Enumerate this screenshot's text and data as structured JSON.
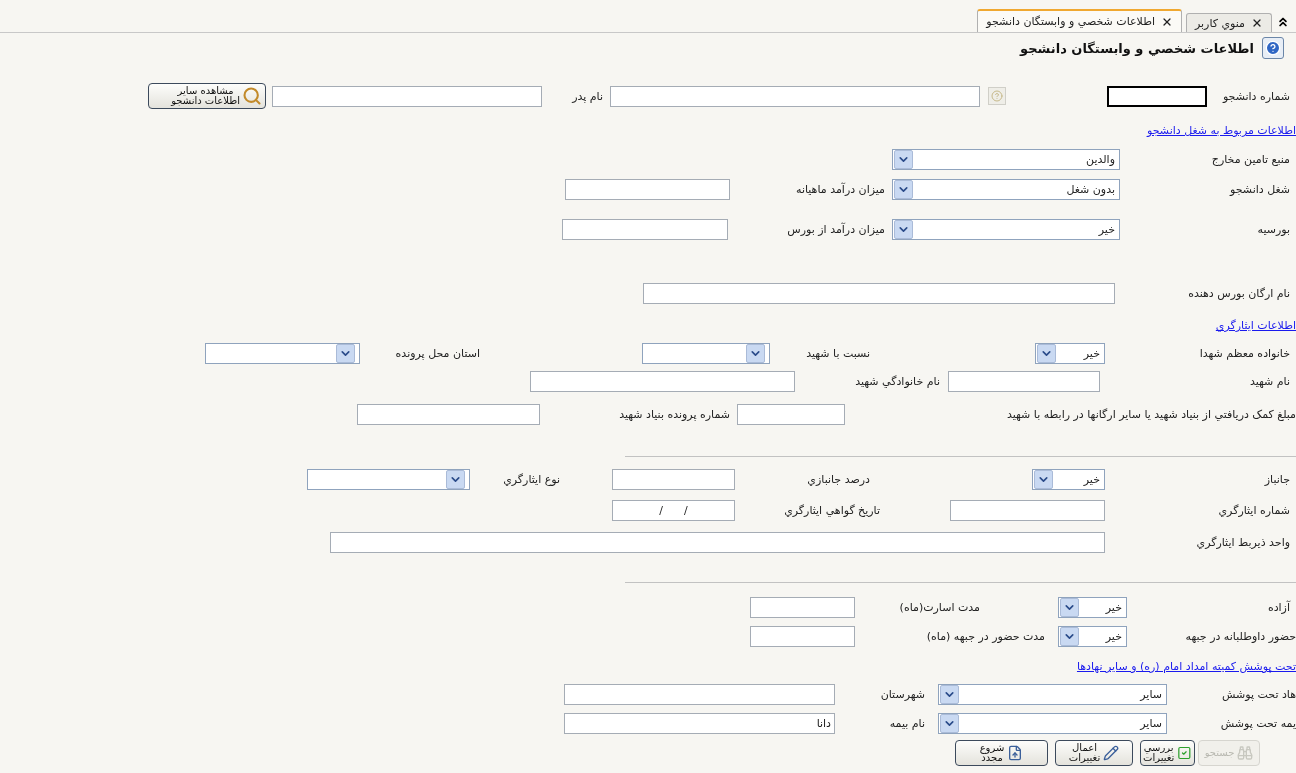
{
  "tabs": [
    {
      "label": "منوي كاربر",
      "selected": false
    },
    {
      "label": "اطلاعات شخصي و وابستگان دانشجو",
      "selected": true
    }
  ],
  "title": "اطلاعات شخصي و وابستگان دانشجو",
  "rows": [
    {
      "kind": "fields",
      "items": [
        {
          "kind": "label",
          "text": "شماره دانشجو"
        },
        {
          "kind": "input",
          "focused": true
        },
        {
          "kind": "help"
        },
        {
          "kind": "input",
          "focused": false
        },
        {
          "kind": "label",
          "text": "نام پدر"
        },
        {
          "kind": "input",
          "focused": false
        },
        {
          "kind": "button",
          "lines": [
            "مشاهده ساير",
            "اطلاعات دانشجو"
          ]
        }
      ]
    },
    {
      "kind": "link",
      "text": "اطلاعات مربوط به شغل دانشجو"
    },
    {
      "kind": "fields",
      "items": [
        {
          "kind": "label",
          "text": "منبع تامين مخارج"
        },
        {
          "kind": "select",
          "value": "والدين"
        }
      ]
    },
    {
      "kind": "fields",
      "items": [
        {
          "kind": "label",
          "text": "شغل دانشجو"
        },
        {
          "kind": "select",
          "value": "بدون شغل"
        },
        {
          "kind": "label",
          "text": "ميزان درآمد ماهيانه"
        },
        {
          "kind": "input",
          "focused": false
        }
      ]
    },
    {
      "kind": "fields",
      "items": [
        {
          "kind": "label",
          "text": "بورسيه"
        },
        {
          "kind": "select",
          "value": "خير"
        },
        {
          "kind": "label",
          "text": "ميزان درآمد از بورس"
        },
        {
          "kind": "input",
          "focused": false
        }
      ]
    },
    {
      "kind": "fields",
      "items": [
        {
          "kind": "label",
          "text": "نام ارگان بورس دهنده"
        },
        {
          "kind": "input",
          "focused": false
        }
      ]
    },
    {
      "kind": "link",
      "text": "اطلاعات ايثارگري"
    },
    {
      "kind": "fields",
      "items": [
        {
          "kind": "label",
          "text": "خانواده معظم شهدا"
        },
        {
          "kind": "select",
          "value": "خير"
        },
        {
          "kind": "label",
          "text": "نسبت با شهيد"
        },
        {
          "kind": "select"
        },
        {
          "kind": "label",
          "text": "استان محل پرونده"
        },
        {
          "kind": "select"
        }
      ]
    },
    {
      "kind": "fields",
      "items": [
        {
          "kind": "label",
          "text": "نام شهيد"
        },
        {
          "kind": "input",
          "focused": false
        },
        {
          "kind": "label",
          "text": "نام خانوادگي شهيد"
        },
        {
          "kind": "input",
          "focused": false
        }
      ]
    },
    {
      "kind": "fields",
      "items": [
        {
          "kind": "label",
          "text": "مبلغ کمک دريافتي از بنياد شهيد يا ساير ارگانها در رابطه با شهيد"
        },
        {
          "kind": "input",
          "focused": false
        },
        {
          "kind": "label",
          "text": "شماره پرونده بنياد شهيد"
        },
        {
          "kind": "input",
          "focused": false
        }
      ]
    },
    {
      "kind": "divider"
    },
    {
      "kind": "fields",
      "items": [
        {
          "kind": "label",
          "text": "جانباز"
        },
        {
          "kind": "select",
          "value": "خير"
        },
        {
          "kind": "label",
          "text": "درصد جانبازي"
        },
        {
          "kind": "input",
          "focused": false
        },
        {
          "kind": "label",
          "text": "نوع ايثارگري"
        },
        {
          "kind": "select"
        }
      ]
    },
    {
      "kind": "fields",
      "items": [
        {
          "kind": "label",
          "text": "شماره ايثارگري"
        },
        {
          "kind": "input",
          "focused": false
        },
        {
          "kind": "label",
          "text": "تاريخ گواهي ايثارگري"
        },
        {
          "kind": "date",
          "value": "/      /"
        }
      ]
    },
    {
      "kind": "fields",
      "items": [
        {
          "kind": "label",
          "text": "واحد ذيربط ايثارگري"
        },
        {
          "kind": "input",
          "focused": false
        }
      ]
    },
    {
      "kind": "divider"
    },
    {
      "kind": "fields",
      "items": [
        {
          "kind": "label",
          "text": "آزاده"
        },
        {
          "kind": "select",
          "value": "خير"
        },
        {
          "kind": "label",
          "text": "مدت اسارت(ماه)"
        },
        {
          "kind": "input",
          "focused": false
        }
      ]
    },
    {
      "kind": "fields",
      "items": [
        {
          "kind": "label",
          "text": "حضور داوطلبانه در جبهه"
        },
        {
          "kind": "select",
          "value": "خير"
        },
        {
          "kind": "label",
          "text": "مدت حضور در جبهه (ماه)"
        },
        {
          "kind": "input",
          "focused": false
        }
      ]
    },
    {
      "kind": "link",
      "text": "تحت پوشش كميته امداد امام (ره) و ساير نهادها"
    },
    {
      "kind": "fields",
      "items": [
        {
          "kind": "label",
          "text": "هاد تحت پوشش"
        },
        {
          "kind": "select",
          "value": "ساير"
        },
        {
          "kind": "label",
          "text": "شهرستان"
        },
        {
          "kind": "input",
          "focused": false
        }
      ]
    },
    {
      "kind": "fields",
      "items": [
        {
          "kind": "label",
          "text": "يمه تحت پوشش"
        },
        {
          "kind": "select",
          "value": "ساير"
        },
        {
          "kind": "label",
          "text": "نام بيمه"
        },
        {
          "kind": "input",
          "value": "دانا",
          "focused": false
        }
      ]
    }
  ],
  "buttons": [
    {
      "lines": [
        "جستجو"
      ],
      "disabled": true
    },
    {
      "lines": [
        "بررسي",
        "تغييرات"
      ],
      "disabled": false
    },
    {
      "lines": [
        "اعمال",
        "تغييرات"
      ],
      "disabled": false
    },
    {
      "lines": [
        "شروع",
        "مجدد"
      ],
      "disabled": false
    }
  ]
}
